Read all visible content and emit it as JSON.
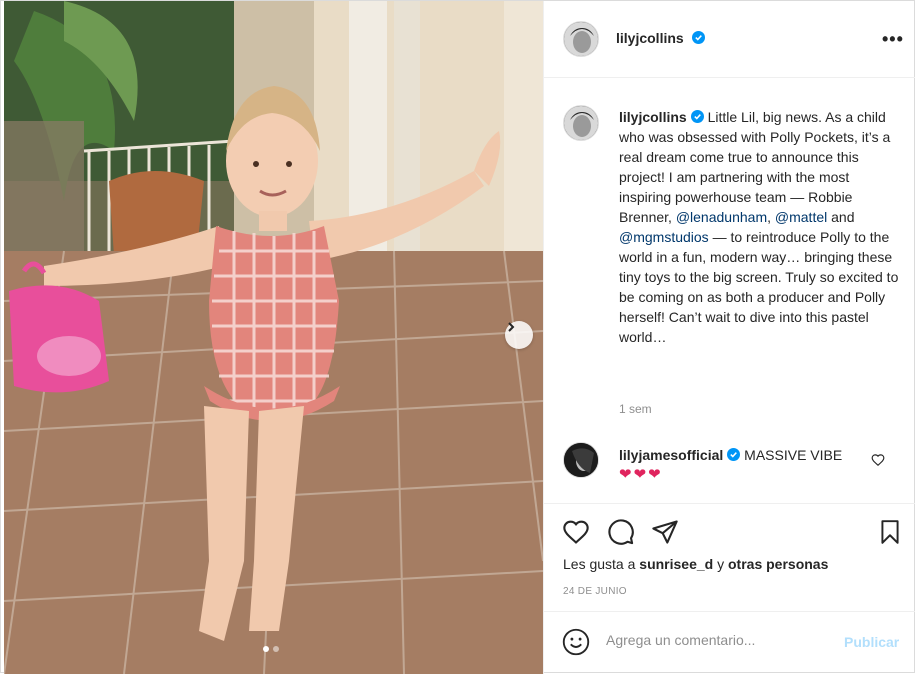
{
  "post": {
    "username": "lilyjcollins",
    "more_icon": "more-horizontal-icon",
    "verified_color": "#0095f6",
    "photo": {
      "description_icon": "photo",
      "carousel_dots": 2,
      "active_dot": 1
    }
  },
  "caption": {
    "username": "lilyjcollins",
    "text_1": "Little Lil, big news. As a child who was obsessed with Polly Pockets, it’s a real dream come true to announce this project! I am partnering with the most inspiring powerhouse team — Robbie Brenner,",
    "mention_1": "@lenadunham",
    "sep_1": ",",
    "mention_2": "@mattel",
    "text_2": "and",
    "mention_3": "@mgmstudios",
    "text_3": "— to reintroduce Polly to the world in a fun, modern way… bringing these tiny toys to the big screen. Truly so excited to be coming on as both a producer and Polly herself! Can’t wait to dive into this pastel world…",
    "time": "1 sem"
  },
  "comment": {
    "username": "lilyjamesofficial",
    "text": "MASSIVE VIBE",
    "hearts": "❤❤❤"
  },
  "actions": {
    "likes_prefix": "Les gusta a",
    "likes_user": "sunrisee_d",
    "likes_join": "y",
    "likes_others": "otras personas",
    "date": "24 DE JUNIO"
  },
  "add_comment": {
    "placeholder": "Agrega un comentario...",
    "publish_label": "Publicar"
  }
}
